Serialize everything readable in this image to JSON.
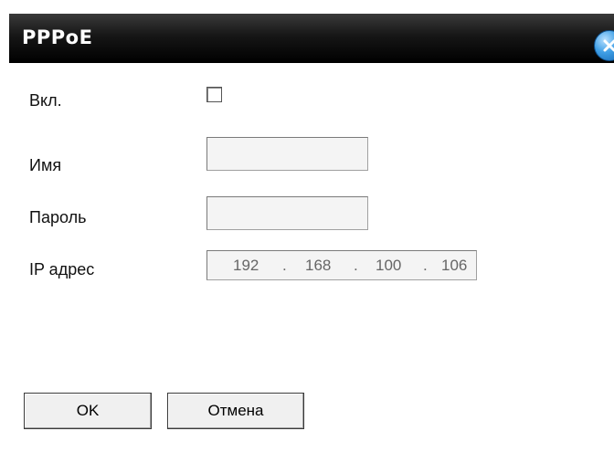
{
  "dialog": {
    "title": "PPPoE",
    "close_icon": "close-icon"
  },
  "form": {
    "enable_label": "Вкл.",
    "enable_checked": false,
    "name_label": "Имя",
    "name_value": "",
    "password_label": "Пароль",
    "password_value": "",
    "ip_label": "IP адрес",
    "ip_octets": [
      "192",
      "168",
      "100",
      "106"
    ],
    "ip_separator": "."
  },
  "buttons": {
    "ok_label": "OK",
    "cancel_label": "Отмена"
  },
  "colors": {
    "titlebar": "#000000",
    "title_text": "#ffffff",
    "close_button": "#3f9fe6",
    "field_background": "#f4f4f4"
  }
}
